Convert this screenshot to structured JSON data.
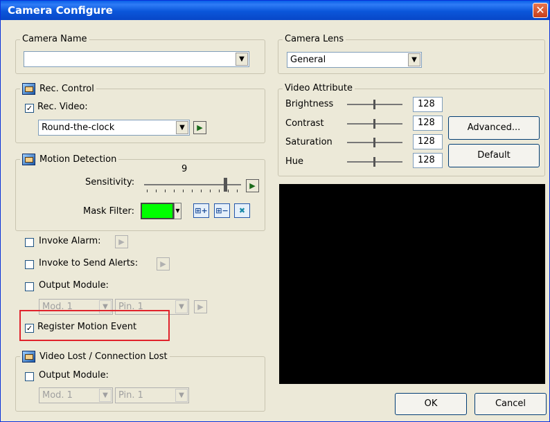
{
  "window": {
    "title": "Camera Configure"
  },
  "camera_name": {
    "label": "Camera Name",
    "value": ""
  },
  "camera_lens": {
    "label": "Camera Lens",
    "value": "General"
  },
  "rec_control": {
    "label": "Rec. Control",
    "rec_video_label": "Rec. Video:",
    "rec_video_checked": true,
    "schedule": "Round-the-clock"
  },
  "motion_detection": {
    "label": "Motion Detection",
    "sensitivity_label": "Sensitivity:",
    "sensitivity_value": "9",
    "mask_filter_label": "Mask Filter:",
    "mask_color": "#00FF00"
  },
  "options": {
    "invoke_alarm": "Invoke Alarm:",
    "invoke_alerts": "Invoke to Send Alerts:",
    "output_module": "Output Module:",
    "module": "Mod. 1",
    "pin": "Pin. 1",
    "register_motion": "Register Motion Event",
    "register_motion_checked": true
  },
  "video_lost": {
    "label": "Video Lost / Connection Lost",
    "output_module": "Output Module:",
    "module": "Mod. 1",
    "pin": "Pin. 1"
  },
  "video_attribute": {
    "label": "Video Attribute",
    "rows": [
      {
        "label": "Brightness",
        "value": "128"
      },
      {
        "label": "Contrast",
        "value": "128"
      },
      {
        "label": "Saturation",
        "value": "128"
      },
      {
        "label": "Hue",
        "value": "128"
      }
    ],
    "advanced_label": "Advanced...",
    "default_label": "Default"
  },
  "footer": {
    "ok_label": "OK",
    "cancel_label": "Cancel"
  },
  "colors": {
    "highlight": "#E0222B",
    "title_bar": "#0A5FE8"
  }
}
